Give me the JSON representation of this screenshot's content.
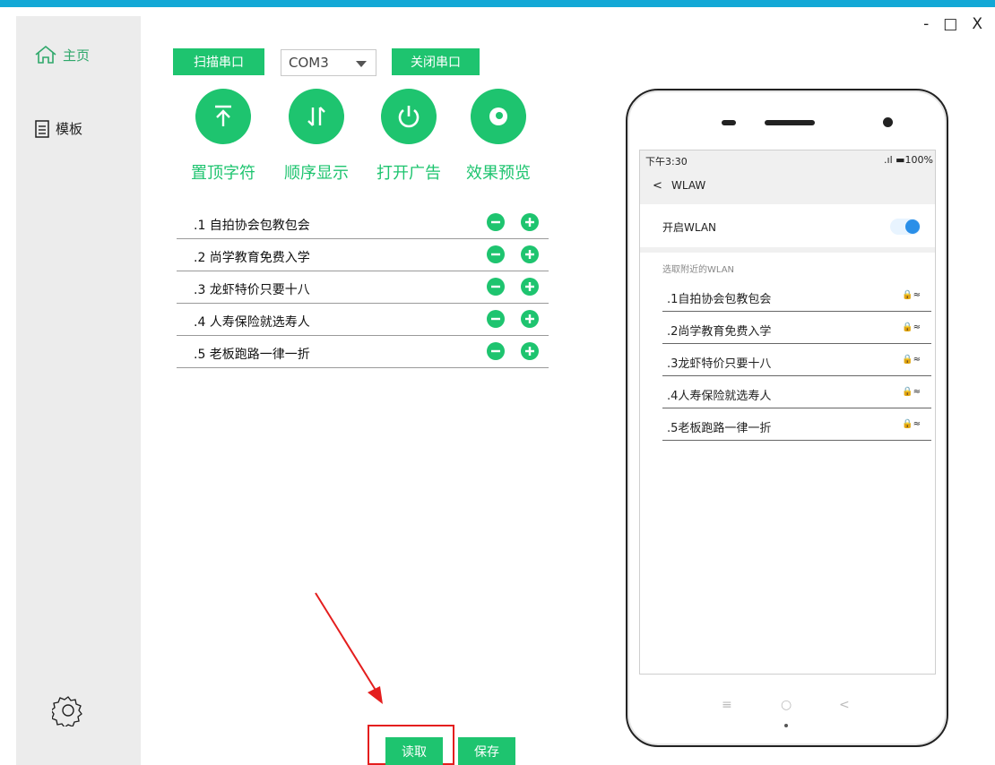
{
  "window": {
    "minimize": "-",
    "maximize": "□",
    "close": "X"
  },
  "sidebar": {
    "home_label": "主页",
    "template_label": "模板"
  },
  "toolbar": {
    "scan_label": "扫描串口",
    "port_value": "COM3",
    "close_label": "关闭串口"
  },
  "functions": [
    {
      "label": "置顶字符",
      "icon": "pin-top-icon"
    },
    {
      "label": "顺序显示",
      "icon": "sort-order-icon"
    },
    {
      "label": "打开广告",
      "icon": "power-icon"
    },
    {
      "label": "效果预览",
      "icon": "eye-icon"
    }
  ],
  "items": [
    {
      "text": ".1  自拍协会包教包会"
    },
    {
      "text": ".2  尚学教育免费入学"
    },
    {
      "text": ".3  龙虾特价只要十八"
    },
    {
      "text": ".4  人寿保险就选寿人"
    },
    {
      "text": ".5  老板跑路一律一折"
    }
  ],
  "actions": {
    "read_label": "读取",
    "save_label": "保存"
  },
  "phone": {
    "time": "下午3:30",
    "battery": ".ıl ▬100%",
    "back": "<",
    "header_title": "WLAW",
    "wlan_toggle_label": "开启WLAN",
    "nearby_label": "选取附近的WLAN",
    "networks": [
      ".1自拍协会包教包会",
      ".2尚学教育免费入学",
      ".3龙虾特价只要十八",
      ".4人寿保险就选寿人",
      ".5老板跑路一律一折"
    ],
    "wifi_icon_glyph": "🔒≈",
    "nav": {
      "menu": "≡",
      "home": "○",
      "back": "<"
    }
  },
  "colors": {
    "accent": "#1ec46f",
    "topbar": "#13a8d6",
    "highlight": "#e41e1e"
  }
}
